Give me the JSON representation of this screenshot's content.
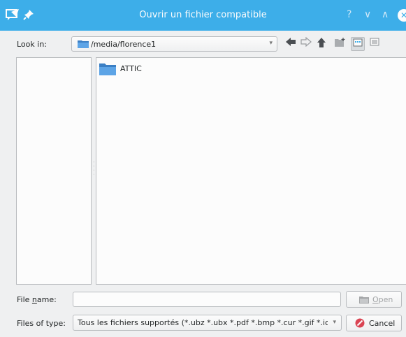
{
  "window": {
    "title": "Ouvrir un fichier compatible",
    "help_symbol": "?",
    "minimize_symbol": "∨",
    "maximize_symbol": "∧",
    "close_symbol": "✕"
  },
  "lookin": {
    "label": "Look in:",
    "path": "/media/florence1",
    "dropdown_symbol": "▾"
  },
  "toolbar": {
    "back_icon": "back-arrow-icon",
    "forward_icon": "forward-arrow-icon",
    "up_icon": "up-arrow-icon",
    "new_folder_icon": "new-folder-icon",
    "list_view_icon": "list-view-icon",
    "detail_view_icon": "detail-view-icon"
  },
  "files": [
    {
      "name": "ATTIC",
      "type": "folder"
    }
  ],
  "filename": {
    "label_prefix": "File ",
    "label_mnemonic": "n",
    "label_suffix": "ame:",
    "value": ""
  },
  "filetype": {
    "label": "Files of type:",
    "value": "Tous les fichiers supportés (*.ubz *.ubx *.pdf *.bmp *.cur *.gif *.icns *.ico *.jpeg *.jpg)",
    "dropdown_symbol": "▾"
  },
  "buttons": {
    "open_mnemonic": "O",
    "open_rest": "pen",
    "cancel": "Cancel"
  },
  "colors": {
    "titlebar": "#3daee9",
    "window_bg": "#eff0f1",
    "view_bg": "#fcfcfc",
    "folder": "#3b7fc4"
  }
}
